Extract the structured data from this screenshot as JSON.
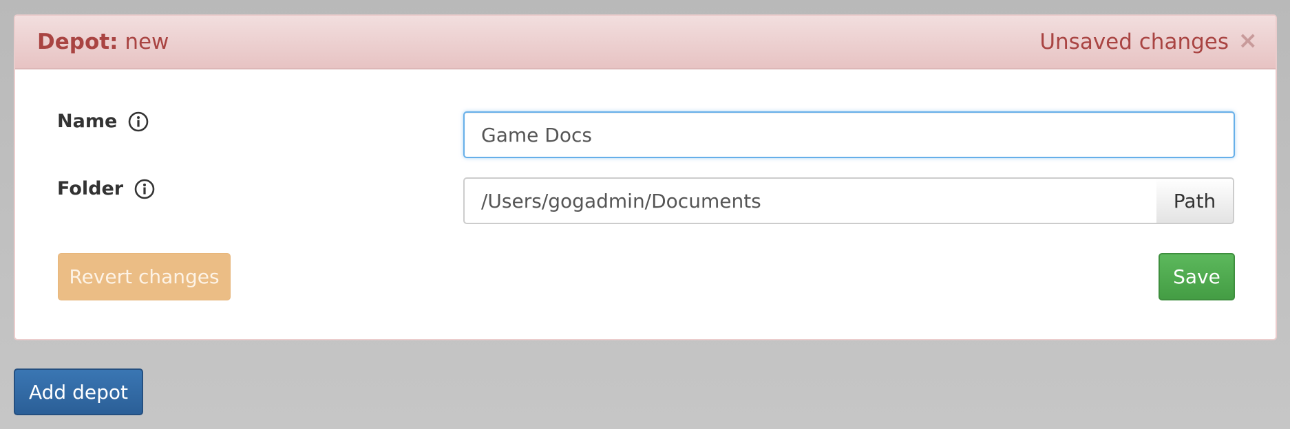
{
  "panel": {
    "title_label": "Depot:",
    "title_value": "new",
    "status": "Unsaved changes",
    "close_glyph": "×"
  },
  "form": {
    "name": {
      "label": "Name",
      "value": "Game Docs",
      "icon": "info-icon"
    },
    "folder": {
      "label": "Folder",
      "value": "/Users/gogadmin/Documents",
      "icon": "info-icon",
      "button_label": "Path"
    }
  },
  "actions": {
    "revert_label": "Revert changes",
    "save_label": "Save"
  },
  "footer": {
    "add_label": "Add depot"
  },
  "colors": {
    "danger_text": "#a94442",
    "danger_bg": "#f2dede",
    "warning_button": "#ebbd85",
    "success_button": "#5cb85c",
    "primary_button": "#337ab7",
    "focus_border": "#66afe9"
  }
}
